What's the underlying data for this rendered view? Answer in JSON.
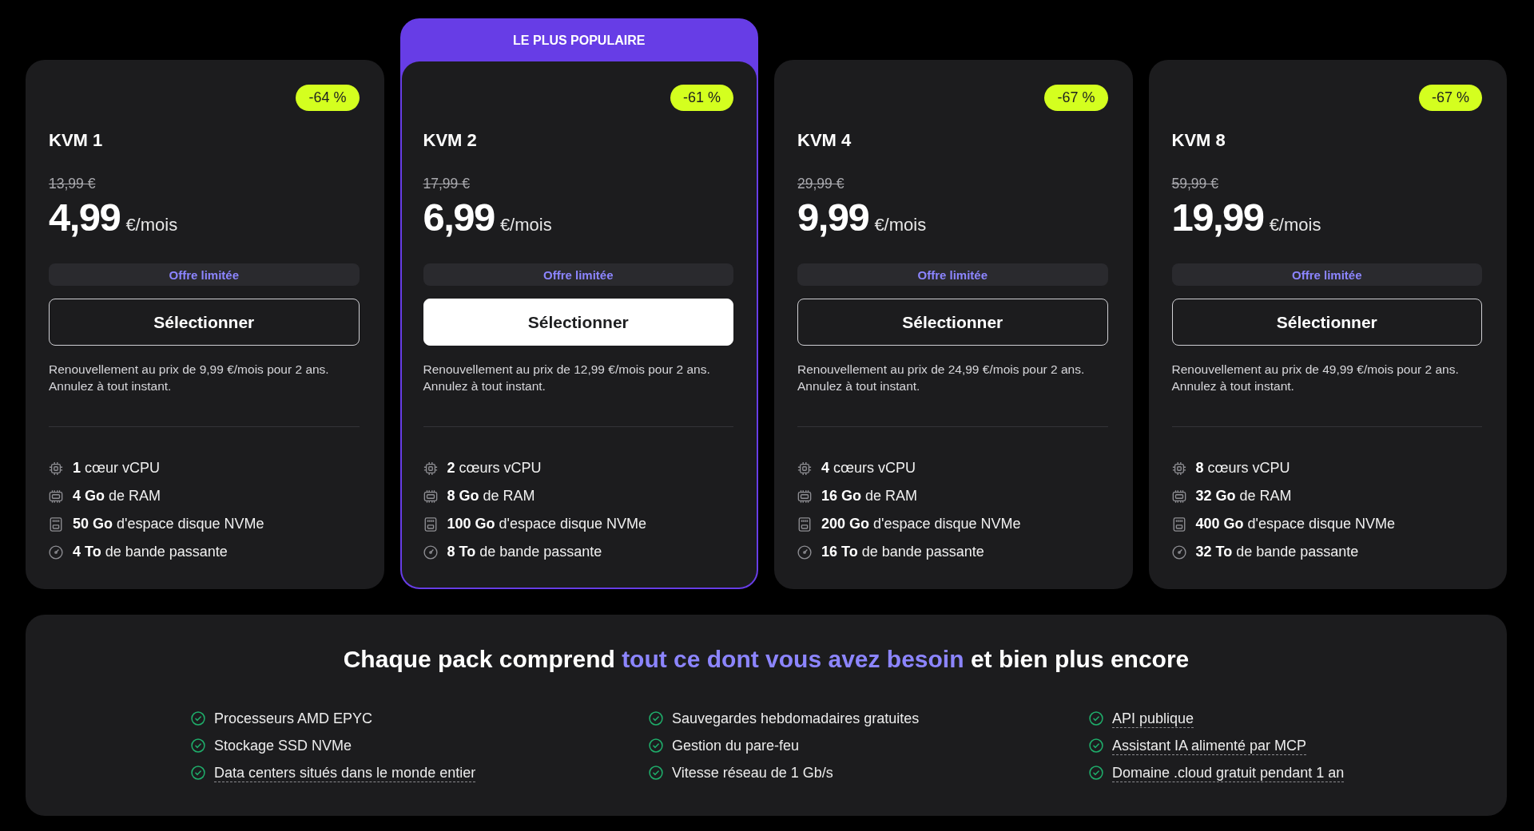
{
  "plans": [
    {
      "name": "KVM 1",
      "featured": false,
      "discount": "-64 %",
      "old_price": "13,99 €",
      "price": "4,99",
      "period": "€/mois",
      "offer": "Offre limitée",
      "button": "Sélectionner",
      "renewal": [
        "Renouvellement au prix de 9,99 €/mois pour 2 ans.",
        "Annulez à tout instant."
      ],
      "features": [
        {
          "kind": "cpu",
          "text": "**1** cœur vCPU"
        },
        {
          "kind": "ram",
          "text": "**4 Go** de RAM"
        },
        {
          "kind": "disk",
          "text": "**50 Go** d'espace disque NVMe"
        },
        {
          "kind": "bandwidth",
          "text": "**4 To** de bande passante"
        }
      ]
    },
    {
      "name": "KVM 2",
      "featured": true,
      "banner": "LE PLUS POPULAIRE",
      "discount": "-61 %",
      "old_price": "17,99 €",
      "price": "6,99",
      "period": "€/mois",
      "offer": "Offre limitée",
      "button": "Sélectionner",
      "renewal": [
        "Renouvellement au prix de 12,99 €/mois pour 2 ans.",
        "Annulez à tout instant."
      ],
      "features": [
        {
          "kind": "cpu",
          "text": "**2** cœurs vCPU"
        },
        {
          "kind": "ram",
          "text": "**8 Go** de RAM"
        },
        {
          "kind": "disk",
          "text": "**100 Go** d'espace disque NVMe"
        },
        {
          "kind": "bandwidth",
          "text": "**8 To** de bande passante"
        }
      ]
    },
    {
      "name": "KVM 4",
      "featured": false,
      "discount": "-67 %",
      "old_price": "29,99 €",
      "price": "9,99",
      "period": "€/mois",
      "offer": "Offre limitée",
      "button": "Sélectionner",
      "renewal": [
        "Renouvellement au prix de 24,99 €/mois pour 2 ans.",
        "Annulez à tout instant."
      ],
      "features": [
        {
          "kind": "cpu",
          "text": "**4** cœurs vCPU"
        },
        {
          "kind": "ram",
          "text": "**16 Go** de RAM"
        },
        {
          "kind": "disk",
          "text": "**200 Go** d'espace disque NVMe"
        },
        {
          "kind": "bandwidth",
          "text": "**16 To** de bande passante"
        }
      ]
    },
    {
      "name": "KVM 8",
      "featured": false,
      "discount": "-67 %",
      "old_price": "59,99 €",
      "price": "19,99",
      "period": "€/mois",
      "offer": "Offre limitée",
      "button": "Sélectionner",
      "renewal": [
        "Renouvellement au prix de 49,99 €/mois pour 2 ans.",
        "Annulez à tout instant."
      ],
      "features": [
        {
          "kind": "cpu",
          "text": "**8** cœurs vCPU"
        },
        {
          "kind": "ram",
          "text": "**32 Go** de RAM"
        },
        {
          "kind": "disk",
          "text": "**400 Go** d'espace disque NVMe"
        },
        {
          "kind": "bandwidth",
          "text": "**32 To** de bande passante"
        }
      ]
    }
  ],
  "included": {
    "heading": {
      "before": "Chaque pack comprend",
      "highlight": "tout ce dont vous avez besoin",
      "after": "et bien plus encore"
    },
    "columns": [
      [
        {
          "text": "Processeurs AMD EPYC",
          "underlined": false
        },
        {
          "text": "Stockage SSD NVMe",
          "underlined": false
        },
        {
          "text": "Data centers situés dans le monde entier",
          "underlined": true
        }
      ],
      [
        {
          "text": "Sauvegardes hebdomadaires gratuites",
          "underlined": false
        },
        {
          "text": "Gestion du pare-feu",
          "underlined": false
        },
        {
          "text": "Vitesse réseau de 1 Gb/s",
          "underlined": false
        }
      ],
      [
        {
          "text": "API publique",
          "underlined": true
        },
        {
          "text": "Assistant IA alimenté par MCP",
          "underlined": true
        },
        {
          "text": "Domaine .cloud gratuit pendant 1 an",
          "underlined": true
        }
      ]
    ]
  }
}
